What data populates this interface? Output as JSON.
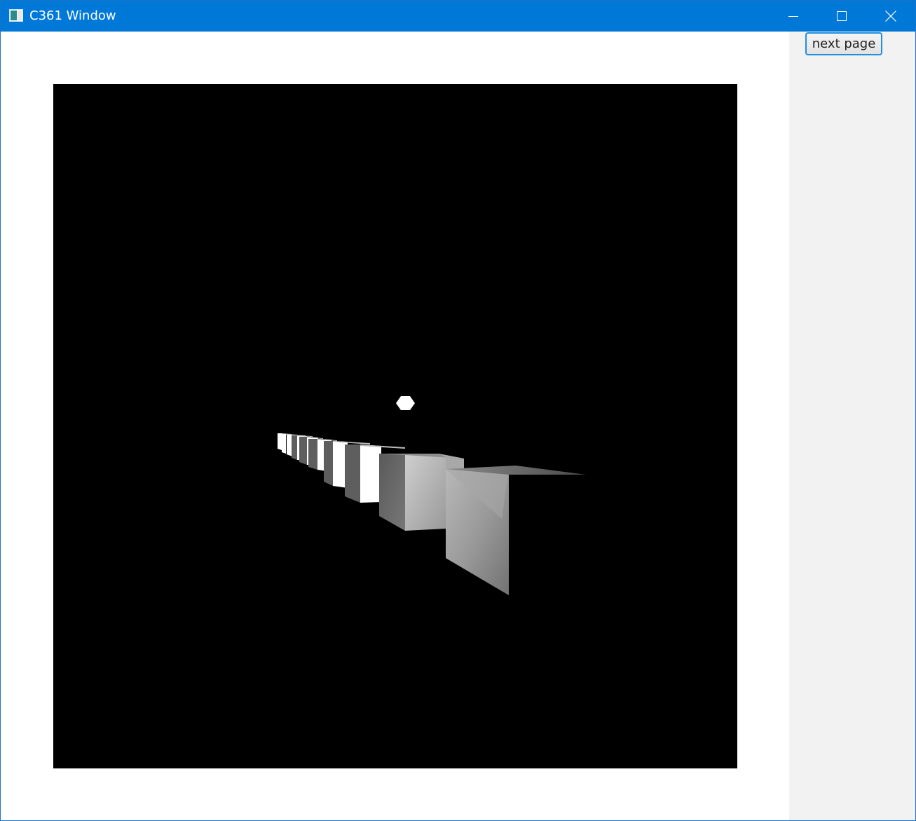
{
  "window": {
    "title": "C361 Window",
    "title_bar_color": "#0078d7"
  },
  "side_panel": {
    "next_page_label": "next page"
  },
  "scene": {
    "background_color": "#000000",
    "objects": [
      "sphere",
      "cube-row"
    ]
  },
  "icons": {
    "app": "app-window-icon",
    "minimize": "minimize-icon",
    "maximize": "maximize-icon",
    "close": "close-icon"
  }
}
